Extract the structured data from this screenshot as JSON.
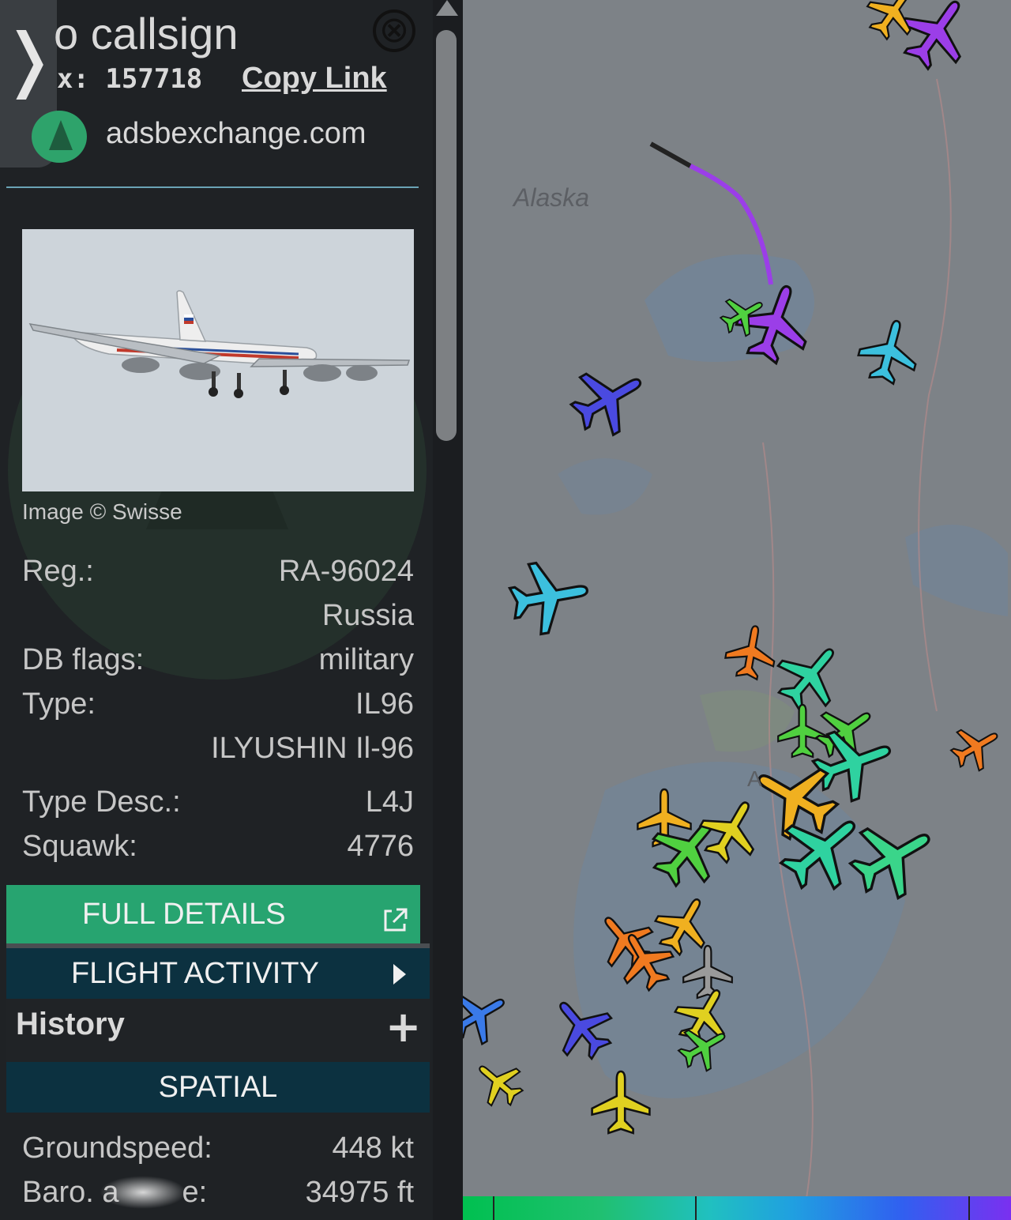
{
  "sidebar": {
    "toggle_glyph": "❭",
    "callsign": "o callsign",
    "close_glyph": "⊗",
    "hex_row": "x: 157718",
    "copy_link": "Copy Link",
    "site": "adsbexchange.com",
    "image_credit": "Image © Swisse",
    "details": [
      {
        "label": "Reg.:",
        "value": "RA-96024"
      },
      {
        "label": "",
        "value": "Russia"
      },
      {
        "label": "DB flags:",
        "value": "military"
      },
      {
        "label": "Type:",
        "value": "IL96"
      },
      {
        "label": "",
        "value": "ILYUSHIN Il-96"
      },
      {
        "label": "Type Desc.:",
        "value": "L4J"
      },
      {
        "label": "Squawk:",
        "value": "4776"
      }
    ],
    "full_details": "FULL DETAILS",
    "external_glyph": "⧉",
    "flight_activity": "FLIGHT ACTIVITY",
    "history": "History",
    "history_toggle": "+",
    "spatial": "SPATIAL",
    "groundspeed": {
      "label": "Groundspeed:",
      "value": "448 kt"
    },
    "baro": {
      "label": "Baro. a",
      "label_tail": "e:",
      "value": "34975 ft"
    }
  },
  "map": {
    "region_label": "Alaska",
    "city_label_fragment": "A",
    "selected_color": "#9b3ee8",
    "aircraft_colors": [
      "#9b3ee8",
      "#3cc0de",
      "#4a4ae0",
      "#f07a20",
      "#2fd2a0",
      "#50d040",
      "#f0b020",
      "#e0d020",
      "#9a9a9a",
      "#3a7ae8"
    ]
  }
}
